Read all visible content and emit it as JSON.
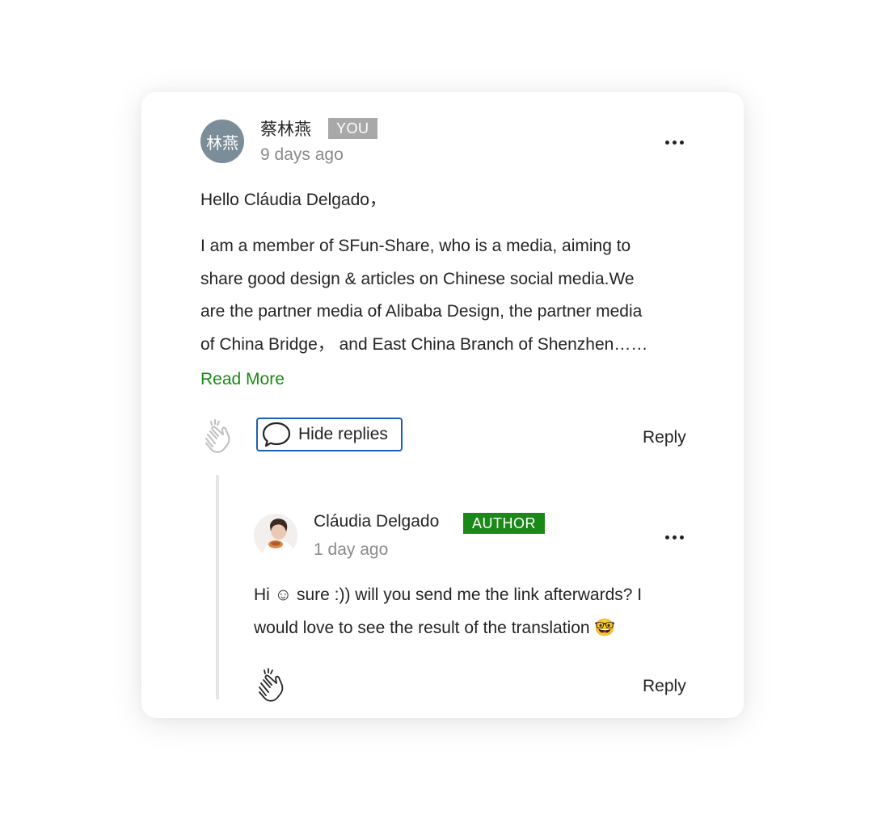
{
  "comment": {
    "avatar_text": "林燕",
    "author": "蔡林燕",
    "badge": "YOU",
    "timestamp": "9 days ago",
    "greeting": "Hello Cláudia Delgado，",
    "body_lines": [
      "I am a member of SFun-Share, who is a media, aiming to",
      "share good design & articles on Chinese social media.We",
      "are the partner media of Alibaba Design, the partner media",
      "of China Bridge，  and East China Branch of Shenzhen……"
    ],
    "read_more": "Read More",
    "hide_replies": "Hide replies",
    "reply": "Reply",
    "icons": {
      "more": "more-horizontal-icon",
      "clap": "clap-icon",
      "bubble": "speech-bubble-icon"
    }
  },
  "reply": {
    "author": "Cláudia Delgado",
    "badge": "AUTHOR",
    "timestamp": "1 day ago",
    "body_lines": [
      "Hi ☺ sure :)) will you send me the link afterwards? I",
      "would love to see the result of the translation 🤓"
    ],
    "reply": "Reply"
  },
  "colors": {
    "accent_green": "#1a8917",
    "focus_blue": "#1a5fb4",
    "avatar_gray": "#7a8d99",
    "badge_gray": "#a8a8a8",
    "thread_line": "#e6e6e6"
  }
}
